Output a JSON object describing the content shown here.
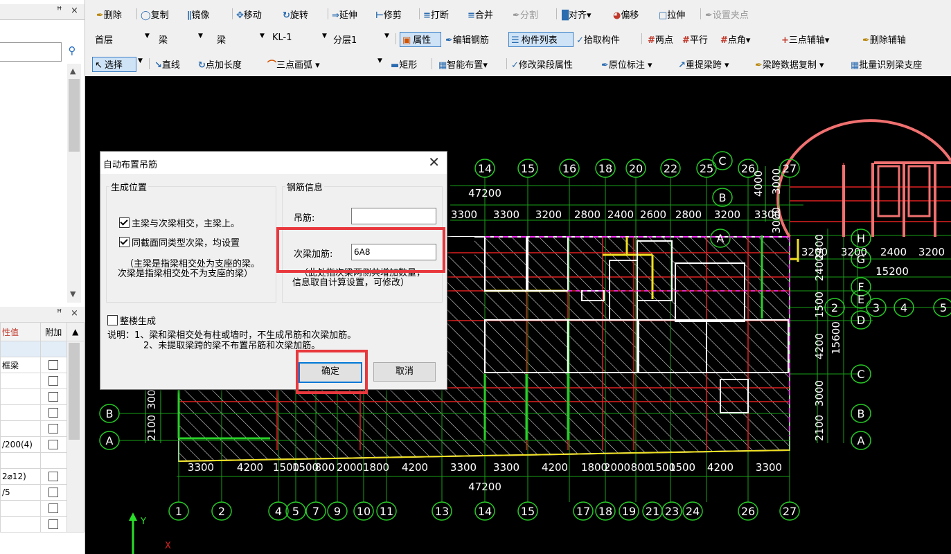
{
  "left_panel": {
    "top_header": {
      "pin": "ꟸ",
      "close": "×"
    },
    "search_placeholder": "",
    "props_header": {
      "pin": "ꟸ",
      "close": "×"
    },
    "props_columns": [
      "性值",
      "附加"
    ],
    "props_rows": [
      "",
      "框梁",
      "",
      "",
      "",
      "",
      "/200(4)",
      "",
      "2⌀12)",
      "/5",
      "",
      ""
    ]
  },
  "toolbar1": {
    "items": [
      "删除",
      "复制",
      "镜像",
      "移动",
      "旋转",
      "延伸",
      "修剪",
      "打断",
      "合并",
      "分割",
      "对齐",
      "偏移",
      "拉伸",
      "设置夹点"
    ]
  },
  "toolbar2": {
    "floor": "首层",
    "type1": "梁",
    "type2": "梁",
    "member": "KL-1",
    "layer": "分层1",
    "props_btn": "属性",
    "edit_rebar": "编辑钢筋",
    "member_list": "构件列表",
    "pick_member": "拾取构件",
    "two_point": "两点",
    "parallel": "平行",
    "point_angle": "点角",
    "three_point_aux": "三点辅轴",
    "delete_aux": "删除辅轴"
  },
  "toolbar3": {
    "select": "选择",
    "line": "直线",
    "point_length": "点加长度",
    "arc": "三点画弧",
    "rect": "矩形",
    "smart_layout": "智能布置",
    "edit_segment": "修改梁段属性",
    "in_situ": "原位标注",
    "repick_span": "重提梁跨",
    "copy_span": "梁跨数据复制",
    "batch_identify": "批量识别梁支座"
  },
  "dialog": {
    "title": "自动布置吊筋",
    "group_position": "生成位置",
    "opt1": "主梁与次梁相交，主梁上。",
    "opt2": "同截面同类型次梁，均设置",
    "note1": "（主梁是指梁相交处为支座的梁。",
    "note2": "次梁是指梁相交处不为支座的梁）",
    "group_rebar": "钢筋信息",
    "hanger_label": "吊筋:",
    "hanger_value": "",
    "extra_label": "次梁加筋:",
    "extra_value": "6A8",
    "extra_note1": "（此处指次梁两侧共增加数量，",
    "extra_note2": "信息取自计算设置，可修改）",
    "whole_building": "整楼生成",
    "desc1": "说明：1、梁和梁相交处有柱或墙时，不生成吊筋和次梁加筋。",
    "desc2": "2、未提取梁跨的梁不布置吊筋和次梁加筋。",
    "ok": "确定",
    "cancel": "取消"
  },
  "cad": {
    "top_axes": [
      "14",
      "15",
      "16",
      "18",
      "20",
      "22",
      "25",
      "26",
      "27"
    ],
    "top_total": "47200",
    "top_dims": [
      "3300",
      "3300",
      "3200",
      "2800",
      "2400",
      "2600",
      "2800",
      "3200",
      "3300"
    ],
    "bottom_axes": [
      "1",
      "2",
      "4",
      "5",
      "7",
      "9",
      "10",
      "11",
      "13",
      "14",
      "15",
      "17",
      "18",
      "19",
      "21",
      "23",
      "24",
      "26",
      "27"
    ],
    "bottom_dims": [
      "3300",
      "4200",
      "1500",
      "1500",
      "800",
      "2000",
      "1800",
      "4200",
      "3300",
      "3300",
      "4200",
      "1800",
      "2000",
      "800",
      "1500",
      "1500",
      "4200",
      "3300"
    ],
    "bottom_total": "47200",
    "right_dims": [
      "3200",
      "3200",
      "2400",
      "3200"
    ],
    "right_total": "15200",
    "right_axes": [
      "2",
      "3",
      "4",
      "5"
    ],
    "row_labels": [
      "C",
      "B",
      "A",
      "H",
      "G",
      "F",
      "E",
      "D",
      "C",
      "B",
      "A",
      "B",
      "A"
    ],
    "vert_dims": [
      "4000",
      "3000",
      "3000",
      "2400",
      "2400",
      "1500",
      "4200",
      "3000",
      "2100",
      "15600",
      "2100",
      "3000"
    ],
    "ucs_y": "Y",
    "ucs_x": "X"
  }
}
